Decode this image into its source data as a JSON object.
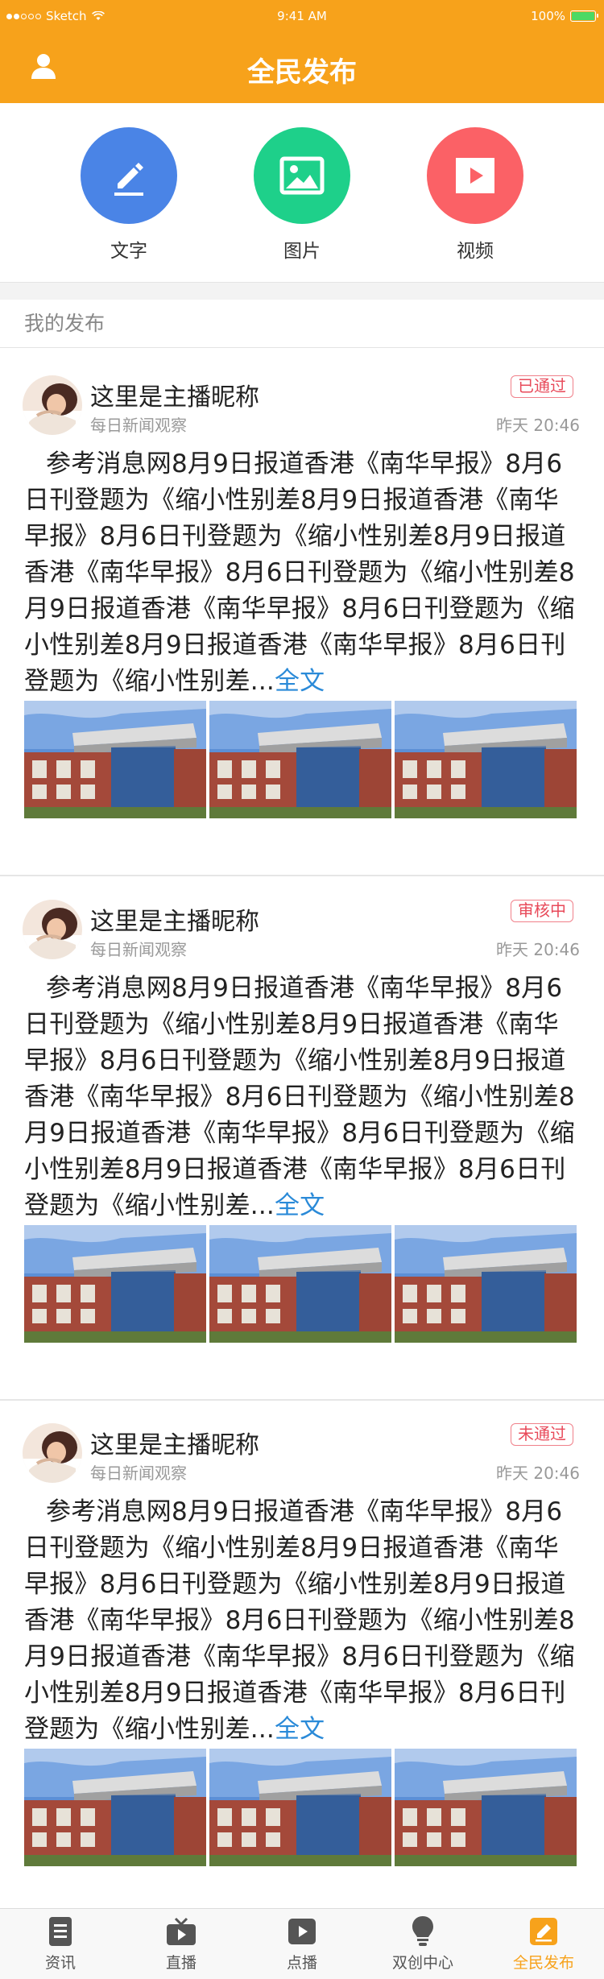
{
  "status_bar": {
    "carrier": "Sketch",
    "time": "9:41 AM",
    "battery": "100%"
  },
  "header": {
    "title": "全民发布",
    "user_icon": "user-icon"
  },
  "publish_actions": [
    {
      "label": "文字",
      "icon": "pencil-icon",
      "color": "#4a84e6"
    },
    {
      "label": "图片",
      "icon": "image-icon",
      "color": "#1ed08a"
    },
    {
      "label": "视频",
      "icon": "video-play-icon",
      "color": "#fb6166"
    }
  ],
  "section": {
    "title": "我的发布"
  },
  "posts": [
    {
      "author": "这里是主播昵称",
      "source": "每日新闻观察",
      "status": "已通过",
      "time": "昨天 20:46",
      "content": "参考消息网8月9日报道香港《南华早报》8月6日刊登题为《缩小性别差8月9日报道香港《南华早报》8月6日刊登题为《缩小性别差8月9日报道香港《南华早报》8月6日刊登题为《缩小性别差8月9日报道香港《南华早报》8月6日刊登题为《缩小性别差8月9日报道香港《南华早报》8月6日刊登题为《缩小性别差...",
      "more": "全文"
    },
    {
      "author": "这里是主播昵称",
      "source": "每日新闻观察",
      "status": "审核中",
      "time": "昨天 20:46",
      "content": "参考消息网8月9日报道香港《南华早报》8月6日刊登题为《缩小性别差8月9日报道香港《南华早报》8月6日刊登题为《缩小性别差8月9日报道香港《南华早报》8月6日刊登题为《缩小性别差8月9日报道香港《南华早报》8月6日刊登题为《缩小性别差8月9日报道香港《南华早报》8月6日刊登题为《缩小性别差...",
      "more": "全文"
    },
    {
      "author": "这里是主播昵称",
      "source": "每日新闻观察",
      "status": "未通过",
      "time": "昨天 20:46",
      "content": "参考消息网8月9日报道香港《南华早报》8月6日刊登题为《缩小性别差8月9日报道香港《南华早报》8月6日刊登题为《缩小性别差8月9日报道香港《南华早报》8月6日刊登题为《缩小性别差8月9日报道香港《南华早报》8月6日刊登题为《缩小性别差8月9日报道香港《南华早报》8月6日刊登题为《缩小性别差...",
      "more": "全文"
    }
  ],
  "tabbar": [
    {
      "label": "资讯",
      "icon": "news-icon",
      "active": false
    },
    {
      "label": "直播",
      "icon": "tv-icon",
      "active": false
    },
    {
      "label": "点播",
      "icon": "play-icon",
      "active": false
    },
    {
      "label": "双创中心",
      "icon": "lightbulb-icon",
      "active": false
    },
    {
      "label": "全民发布",
      "icon": "edit-icon",
      "active": true
    }
  ],
  "colors": {
    "brand": "#f7a21b",
    "link": "#2a8ad8",
    "status_border": "#f0808a",
    "status_text": "#e84a5a"
  }
}
